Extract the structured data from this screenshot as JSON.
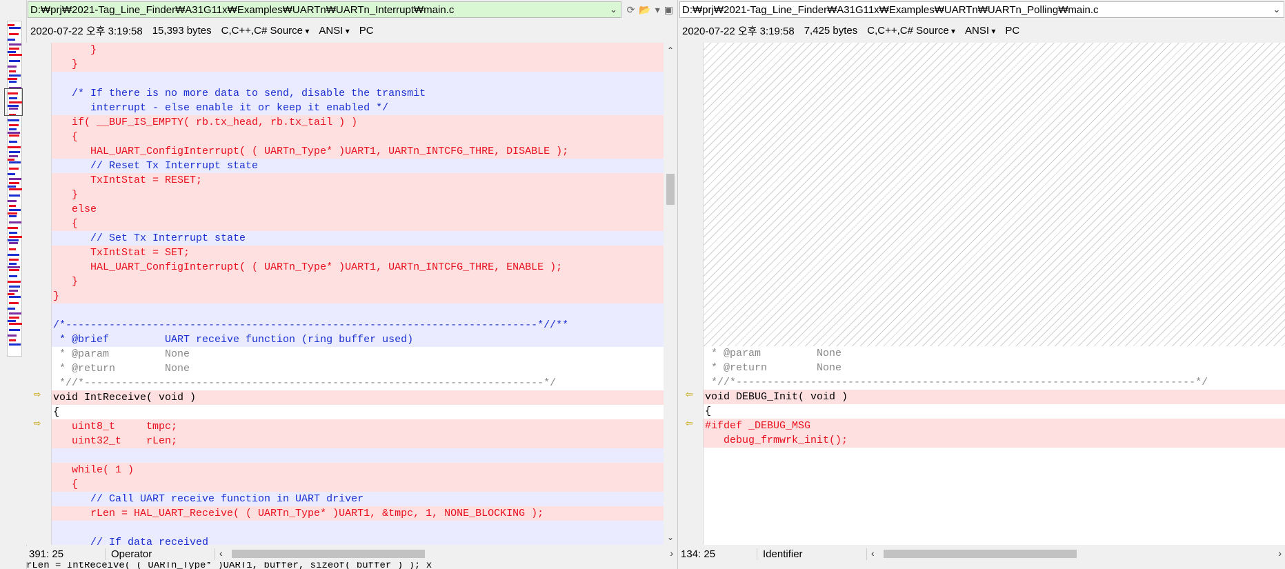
{
  "left": {
    "path": "D:₩prj₩2021-Tag_Line_Finder₩A31G11x₩Examples₩UARTn₩UARTn_Interrupt₩main.c",
    "info": {
      "date": "2020-07-22 오후 3:19:58",
      "size": "15,393 bytes",
      "type": "C,C++,C# Source",
      "encoding": "ANSI",
      "eol": "PC"
    },
    "status": {
      "position": "391: 25",
      "token": "Operator"
    },
    "lines": [
      {
        "style": "red",
        "text": "      }"
      },
      {
        "style": "red",
        "text": "   }"
      },
      {
        "style": "blue",
        "text": ""
      },
      {
        "style": "blue",
        "text": "   /* If there is no more data to send, disable the transmit"
      },
      {
        "style": "blue",
        "text": "      interrupt - else enable it or keep it enabled */"
      },
      {
        "style": "red",
        "text": "   if( __BUF_IS_EMPTY( rb.tx_head, rb.tx_tail ) )"
      },
      {
        "style": "red",
        "text": "   {"
      },
      {
        "style": "red",
        "text": "      HAL_UART_ConfigInterrupt( ( UARTn_Type* )UART1, UARTn_INTCFG_THRE, DISABLE );"
      },
      {
        "style": "blue",
        "text": "      // Reset Tx Interrupt state"
      },
      {
        "style": "red",
        "text": "      TxIntStat = RESET;"
      },
      {
        "style": "red",
        "text": "   }"
      },
      {
        "style": "red",
        "text": "   else"
      },
      {
        "style": "red",
        "text": "   {"
      },
      {
        "style": "blue",
        "text": "      // Set Tx Interrupt state"
      },
      {
        "style": "red",
        "text": "      TxIntStat = SET;"
      },
      {
        "style": "red",
        "text": "      HAL_UART_ConfigInterrupt( ( UARTn_Type* )UART1, UARTn_INTCFG_THRE, ENABLE );"
      },
      {
        "style": "red",
        "text": "   }"
      },
      {
        "style": "red",
        "text": "}"
      },
      {
        "style": "blue",
        "text": ""
      },
      {
        "style": "blue",
        "text": "/*----------------------------------------------------------------------------*//**"
      },
      {
        "style": "blue",
        "text": " * @brief         UART receive function (ring buffer used)"
      },
      {
        "style": "gray",
        "text": " * @param         None"
      },
      {
        "style": "gray",
        "text": " * @return        None"
      },
      {
        "style": "gray",
        "text": " *//*--------------------------------------------------------------------------*/"
      },
      {
        "style": "redbg-black",
        "text": "void IntReceive( void )"
      },
      {
        "style": "plain",
        "text": "{"
      },
      {
        "style": "red",
        "text": "   uint8_t     tmpc;"
      },
      {
        "style": "red",
        "text": "   uint32_t    rLen;"
      },
      {
        "style": "blue",
        "text": ""
      },
      {
        "style": "red",
        "text": "   while( 1 )"
      },
      {
        "style": "red",
        "text": "   {"
      },
      {
        "style": "blue",
        "text": "      // Call UART receive function in UART driver"
      },
      {
        "style": "red",
        "text": "      rLen = HAL_UART_Receive( ( UARTn_Type* )UART1, &tmpc, 1, NONE_BLOCKING );"
      },
      {
        "style": "blue",
        "text": ""
      },
      {
        "style": "blue",
        "text": "      // If data received"
      }
    ]
  },
  "right": {
    "path": "D:₩prj₩2021-Tag_Line_Finder₩A31G11x₩Examples₩UARTn₩UARTn_Polling₩main.c",
    "info": {
      "date": "2020-07-22 오후 3:19:58",
      "size": "7,425 bytes",
      "type": "C,C++,C# Source",
      "encoding": "ANSI",
      "eol": "PC"
    },
    "status": {
      "position": "134: 25",
      "token": "Identifier"
    },
    "lines": [
      {
        "style": "gray",
        "text": " * @param         None"
      },
      {
        "style": "gray",
        "text": " * @return        None"
      },
      {
        "style": "gray",
        "text": " *//*--------------------------------------------------------------------------*/"
      },
      {
        "style": "redbg-black",
        "text": "void DEBUG_Init( void )"
      },
      {
        "style": "plain",
        "text": "{"
      },
      {
        "style": "red",
        "text": "#ifdef _DEBUG_MSG"
      },
      {
        "style": "red",
        "text": "   debug_frmwrk_init();"
      }
    ]
  },
  "bottom_text": "      rLen = IntReceive( ( UARTn_Type* )UART1, buffer, sizeof( buffer ) ); x"
}
